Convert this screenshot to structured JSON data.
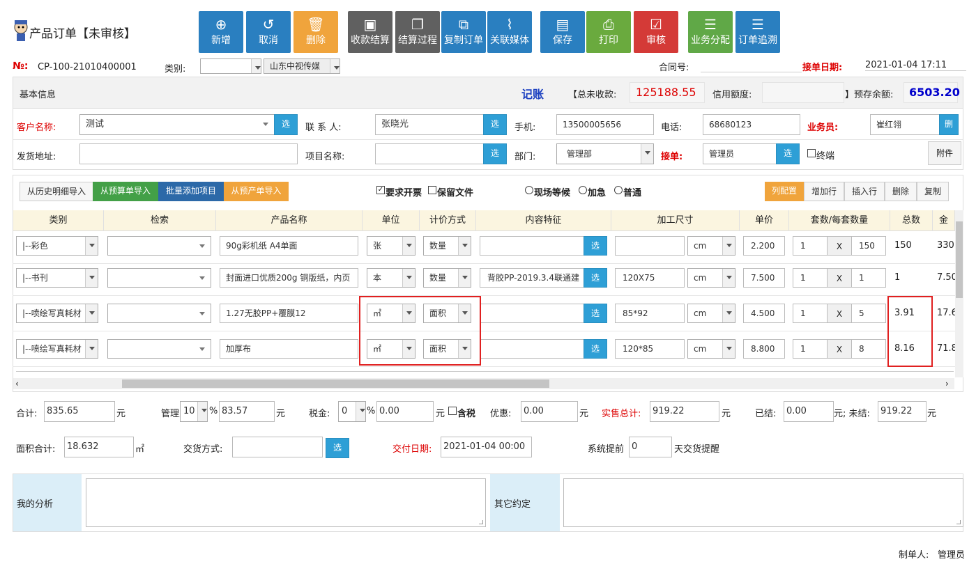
{
  "header": {
    "title": "产品订单【未审核】",
    "toolbar": [
      {
        "label": "新增",
        "icon": "plus-circle-icon",
        "glyph": "⊕"
      },
      {
        "label": "取消",
        "icon": "undo-icon",
        "glyph": "↺"
      },
      {
        "label": "删除",
        "icon": "trash-icon",
        "glyph": "🗑"
      },
      {
        "label": "收款结算",
        "icon": "money-icon",
        "glyph": "▣"
      },
      {
        "label": "结算过程",
        "icon": "copy-icon",
        "glyph": "❐"
      },
      {
        "label": "复制订单",
        "icon": "duplicate-icon",
        "glyph": "⧉"
      },
      {
        "label": "关联媒体",
        "icon": "paperclip-icon",
        "glyph": "⌇"
      },
      {
        "label": "保存",
        "icon": "save-icon",
        "glyph": "▤"
      },
      {
        "label": "打印",
        "icon": "print-icon",
        "glyph": "⎙"
      },
      {
        "label": "审核",
        "icon": "check-icon",
        "glyph": "☑"
      },
      {
        "label": "业务分配",
        "icon": "list-icon",
        "glyph": "☰"
      },
      {
        "label": "订单追溯",
        "icon": "list-icon",
        "glyph": "☰"
      }
    ]
  },
  "order": {
    "no_label": "№:",
    "no": "CP-100-21010400001",
    "category_label": "类别:",
    "category_value": "",
    "company": "山东中视传媒",
    "contract_label": "合同号:",
    "contract_value": "",
    "date_label": "接单日期:",
    "date": "2021-01-04 17:11"
  },
  "basic": {
    "title": "基本信息",
    "bookkeeping": "记账",
    "total_unpaid_label": "【总未收款:",
    "total_unpaid": "125188.55",
    "credit_label": "信用额度:",
    "credit_value": "",
    "prepaid_label": "】预存余额:",
    "prepaid": "6503.20"
  },
  "customer": {
    "name_label": "客户名称:",
    "name": "测试",
    "contact_label": "联 系 人:",
    "contact": "张晓光",
    "mobile_label": "手机:",
    "mobile": "13500005656",
    "phone_label": "电话:",
    "phone": "68680123",
    "sales_label": "业务员:",
    "sales": "崔红翎",
    "address_label": "发货地址:",
    "address": "",
    "project_label": "项目名称:",
    "project": "",
    "dept_label": "部门:",
    "dept": "管理部",
    "receiver_label": "接单:",
    "receiver": "管理员",
    "terminal_label": "终端",
    "attach_label": "附件",
    "pick": "选",
    "del": "删"
  },
  "import_bar": {
    "history": "从历史明细导入",
    "budget": "从预算单导入",
    "batch": "批量添加项目",
    "preprod": "从预产单导入",
    "invoice": "要求开票",
    "keep_file": "保留文件",
    "wait": "现场等候",
    "urgent": "加急",
    "normal": "普通",
    "col_config": "列配置",
    "add_row": "增加行",
    "insert_row": "插入行",
    "delete": "删除",
    "copy": "复制"
  },
  "grid": {
    "columns": [
      "类别",
      "检索",
      "产品名称",
      "单位",
      "计价方式",
      "内容特征",
      "加工尺寸",
      "单价",
      "套数/每套数量",
      "总数",
      "金"
    ],
    "rows": [
      {
        "category": "|--彩色",
        "search": "",
        "product": "90g彩机纸 A4单面",
        "unit": "张",
        "pricing": "数量",
        "content": "",
        "size": "",
        "size_unit": "cm",
        "price": "2.200",
        "sets": "1",
        "per_set": "150",
        "total": "150",
        "amount": "330"
      },
      {
        "category": "|--书刊",
        "search": "",
        "product": "封面进口优质200g 铜版纸，内页",
        "unit": "本",
        "pricing": "数量",
        "content": "背胶PP-2019.3.4联通建",
        "size": "120X75",
        "size_unit": "cm",
        "price": "7.500",
        "sets": "1",
        "per_set": "1",
        "total": "1",
        "amount": "7.50"
      },
      {
        "category": "|--喷绘写真耗材",
        "search": "",
        "product": "1.27无胶PP+覆膜12",
        "unit": "㎡",
        "pricing": "面积",
        "content": "",
        "size": "85*92",
        "size_unit": "cm",
        "price": "4.500",
        "sets": "1",
        "per_set": "5",
        "total": "3.91",
        "amount": "17.6"
      },
      {
        "category": "|--喷绘写真耗材",
        "search": "",
        "product": "加厚布",
        "unit": "㎡",
        "pricing": "面积",
        "content": "",
        "size": "120*85",
        "size_unit": "cm",
        "price": "8.800",
        "sets": "1",
        "per_set": "8",
        "total": "8.16",
        "amount": "71.8"
      }
    ],
    "times": "X",
    "pick": "选"
  },
  "totals": {
    "sum_label": "合计:",
    "sum": "835.65",
    "yuan": "元",
    "mgmt_label": "管理费:",
    "mgmt_rate": "10",
    "pct": "%",
    "mgmt": "83.57",
    "tax_label": "税金:",
    "tax_rate": "0",
    "tax": "0.00",
    "tax_incl": "含税",
    "discount_label": "优惠:",
    "discount": "0.00",
    "actual_label": "实售总计:",
    "actual": "919.22",
    "settled_label": "已结:",
    "settled": "0.00",
    "unsettled_label": "元; 未结:",
    "unsettled": "919.22",
    "area_label": "面积合计:",
    "area": "18.632",
    "sqm": "㎡",
    "delivery_label": "交货方式:",
    "delivery": "",
    "pick": "选",
    "deliver_date_label": "交付日期:",
    "deliver_date": "2021-01-04 00:00",
    "remind_label": "系统提前",
    "remind_days": "0",
    "remind_suffix": "天交货提醒"
  },
  "notes": {
    "analysis_label": "我的分析",
    "analysis": "",
    "other_label": "其它约定",
    "other": ""
  },
  "footer": {
    "maker_label": "制单人:",
    "maker": "管理员"
  },
  "colors": {
    "accent": "#2e9fd6",
    "highlight": "#e02020",
    "unpaid": "#d00000",
    "prepaid": "#0000cc"
  }
}
